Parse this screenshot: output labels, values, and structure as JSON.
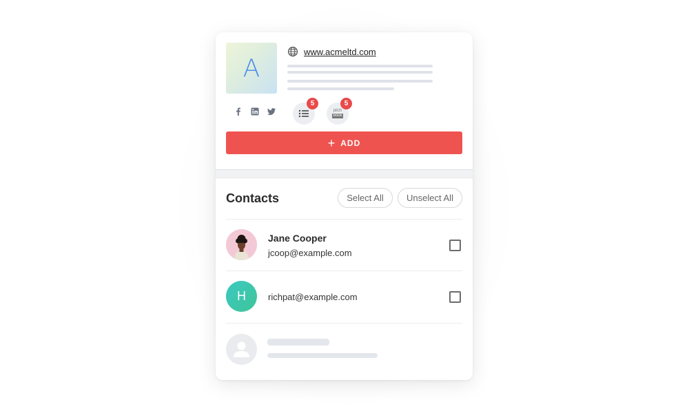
{
  "company": {
    "logo_letter": "A",
    "website": "www.acmeltd.com",
    "icons": {
      "globe": "globe-icon",
      "facebook": "facebook-icon",
      "linkedin": "linkedin-icon",
      "twitter": "twitter-icon",
      "list": "list-icon",
      "pitchbook": "pitchbook-icon"
    },
    "list_badge": "5",
    "pitchbook_badge": "5",
    "pitchbook_text_top": "pitch",
    "pitchbook_text_bottom": "book",
    "add_label": "ADD"
  },
  "contacts": {
    "title": "Contacts",
    "select_all": "Select All",
    "unselect_all": "Unselect All",
    "items": [
      {
        "name": "Jane Cooper",
        "email": "jcoop@example.com",
        "avatar": "photo"
      },
      {
        "name": "",
        "email": "richpat@example.com",
        "avatar": "H"
      }
    ]
  },
  "colors": {
    "accent": "#ef5350",
    "badge": "#ea4a4a",
    "logo_letter": "#4f8ee6",
    "avatar_teal": "#3ac9c0"
  }
}
